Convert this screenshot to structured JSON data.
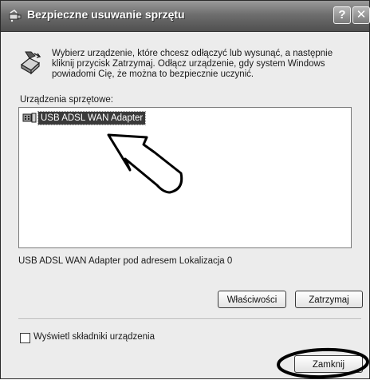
{
  "window": {
    "title": "Bezpieczne usuwanie sprzętu",
    "help_label": "?",
    "close_label": "✕"
  },
  "intro": {
    "text": "Wybierz urządzenie, które chcesz odłączyć lub wysunąć, a następnie kliknij przycisk Zatrzymaj. Odłącz urządzenie, gdy system Windows powiadomi Cię, że można to bezpiecznie uczynić."
  },
  "devices": {
    "label": "Urządzenia sprzętowe:",
    "items": [
      {
        "name": "USB ADSL WAN Adapter",
        "selected": true,
        "icon": "network-adapter-icon"
      }
    ]
  },
  "location_text": "USB ADSL WAN Adapter pod adresem Lokalizacja 0",
  "buttons": {
    "properties": "Właściwości",
    "stop": "Zatrzymaj",
    "close": "Zamknij"
  },
  "checkbox": {
    "label": "Wyświetl składniki urządzenia",
    "checked": false
  },
  "annotations": {
    "arrow": "hand-drawn-arrow",
    "ring": "hand-drawn-ellipse"
  }
}
